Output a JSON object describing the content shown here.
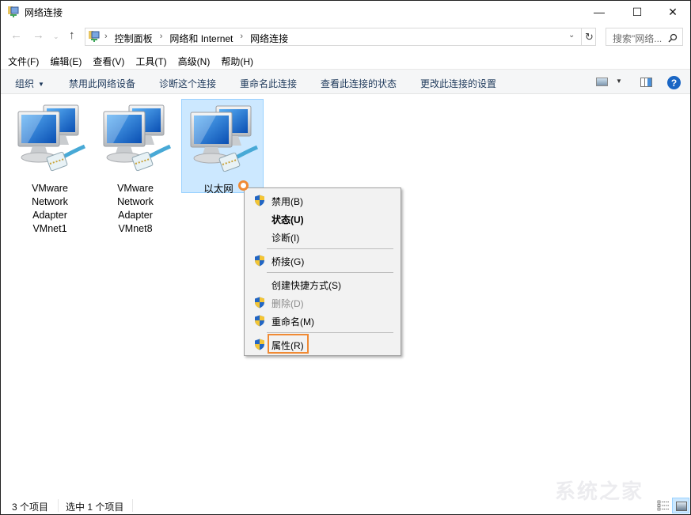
{
  "window": {
    "title": "网络连接",
    "controls": {
      "minimize": "—",
      "maximize": "☐",
      "close": "✕"
    }
  },
  "navigation": {
    "back": "←",
    "forward": "→",
    "recent": "⌄",
    "up": "↑"
  },
  "address": {
    "crumbs": [
      "控制面板",
      "网络和 Internet",
      "网络连接"
    ],
    "separator": "›",
    "dropdown": "⌄",
    "refresh": "↻"
  },
  "search": {
    "placeholder": "搜索\"网络...",
    "icon": "⚲"
  },
  "menubar": {
    "items": [
      "文件(F)",
      "编辑(E)",
      "查看(V)",
      "工具(T)",
      "高级(N)",
      "帮助(H)"
    ]
  },
  "commandbar": {
    "organize": "组织",
    "caret": "▼",
    "commands": [
      "禁用此网络设备",
      "诊断这个连接",
      "重命名此连接",
      "查看此连接的状态",
      "更改此连接的设置"
    ],
    "view_caret": "▼",
    "help": "?"
  },
  "items": [
    {
      "lines": [
        "VMware",
        "Network",
        "Adapter",
        "VMnet1"
      ],
      "selected": false
    },
    {
      "lines": [
        "VMware",
        "Network",
        "Adapter",
        "VMnet8"
      ],
      "selected": false
    },
    {
      "lines": [
        "以太网"
      ],
      "selected": true
    }
  ],
  "context_menu": {
    "items": [
      {
        "label": "禁用(B)",
        "shield": true,
        "style": "normal"
      },
      {
        "label": "状态(U)",
        "shield": false,
        "style": "bold"
      },
      {
        "label": "诊断(I)",
        "shield": false,
        "style": "normal"
      },
      {
        "label": "桥接(G)",
        "shield": true,
        "style": "normal"
      },
      {
        "label": "创建快捷方式(S)",
        "shield": false,
        "style": "normal"
      },
      {
        "label": "删除(D)",
        "shield": true,
        "style": "disabled"
      },
      {
        "label": "重命名(M)",
        "shield": true,
        "style": "normal"
      },
      {
        "label": "属性(R)",
        "shield": true,
        "style": "highlighted"
      }
    ]
  },
  "statusbar": {
    "count": "3 个项目",
    "selected": "选中 1 个项目"
  },
  "watermark": "系统之家",
  "colors": {
    "accent_highlight": "#f08a34",
    "selection_bg": "#cce8ff",
    "selection_border": "#99d1ff",
    "command_text": "#1e395b",
    "help_blue": "#1a66c4"
  }
}
